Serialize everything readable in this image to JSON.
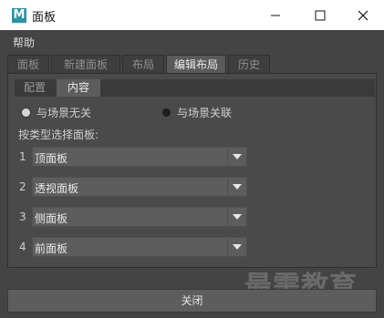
{
  "window": {
    "title": "面板",
    "icon_letter": "M"
  },
  "menubar": {
    "help_label": "帮助"
  },
  "tabs": [
    {
      "label": "面板",
      "active": false
    },
    {
      "label": "新建面板",
      "active": false
    },
    {
      "label": "布局",
      "active": false
    },
    {
      "label": "编辑布局",
      "active": true
    },
    {
      "label": "历史",
      "active": false
    }
  ],
  "subtabs": [
    {
      "label": "配置",
      "active": false
    },
    {
      "label": "内容",
      "active": true
    }
  ],
  "radios": [
    {
      "label": "与场景无关",
      "checked": true
    },
    {
      "label": "与场景关联",
      "checked": false
    }
  ],
  "section_label": "按类型选择面板:",
  "panel_rows": [
    {
      "num": "1",
      "value": "顶面板"
    },
    {
      "num": "2",
      "value": "透视面板"
    },
    {
      "num": "3",
      "value": "侧面板"
    },
    {
      "num": "4",
      "value": "前面板"
    }
  ],
  "close_label": "关闭",
  "watermark": "最需教育"
}
